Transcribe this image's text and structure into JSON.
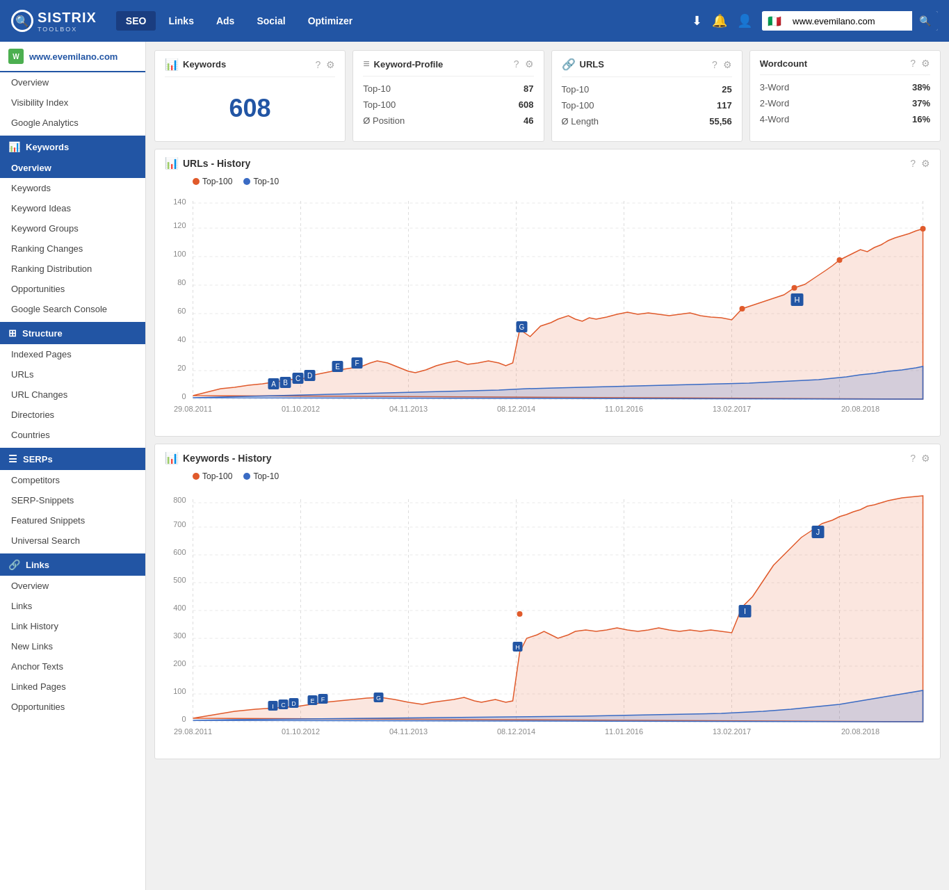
{
  "header": {
    "logo": "SISTRIX",
    "logo_sub": "TOOLBOX",
    "search_placeholder": "www.evemilano.com",
    "flag": "🇮🇹",
    "nav": [
      {
        "label": "SEO",
        "active": true
      },
      {
        "label": "Links",
        "active": false
      },
      {
        "label": "Ads",
        "active": false
      },
      {
        "label": "Social",
        "active": false
      },
      {
        "label": "Optimizer",
        "active": false
      }
    ]
  },
  "sidebar": {
    "domain": "www.evemilano.com",
    "items_top": [
      {
        "label": "Overview"
      },
      {
        "label": "Visibility Index"
      },
      {
        "label": "Google Analytics"
      }
    ],
    "section_keywords": "Keywords",
    "keywords_items": [
      {
        "label": "Overview",
        "active": true
      },
      {
        "label": "Keywords"
      },
      {
        "label": "Keyword Ideas"
      },
      {
        "label": "Keyword Groups"
      },
      {
        "label": "Ranking Changes"
      },
      {
        "label": "Ranking Distribution"
      },
      {
        "label": "Opportunities"
      },
      {
        "label": "Google Search Console"
      }
    ],
    "section_structure": "Structure",
    "structure_items": [
      {
        "label": "Indexed Pages"
      },
      {
        "label": "URLs"
      },
      {
        "label": "URL Changes"
      },
      {
        "label": "Directories"
      },
      {
        "label": "Countries"
      }
    ],
    "section_serps": "SERPs",
    "serps_items": [
      {
        "label": "Competitors"
      },
      {
        "label": "SERP-Snippets"
      },
      {
        "label": "Featured Snippets"
      },
      {
        "label": "Universal Search"
      }
    ],
    "section_links": "Links",
    "links_items": [
      {
        "label": "Overview"
      },
      {
        "label": "Links"
      },
      {
        "label": "Link History"
      },
      {
        "label": "New Links"
      },
      {
        "label": "Anchor Texts"
      },
      {
        "label": "Linked Pages"
      },
      {
        "label": "Opportunities"
      }
    ]
  },
  "stats": {
    "keywords": {
      "title": "Keywords",
      "big_value": "608"
    },
    "keyword_profile": {
      "title": "Keyword-Profile",
      "rows": [
        {
          "label": "Top-10",
          "value": "87"
        },
        {
          "label": "Top-100",
          "value": "608"
        },
        {
          "label": "Ø Position",
          "value": "46"
        }
      ]
    },
    "urls": {
      "title": "URLS",
      "rows": [
        {
          "label": "Top-10",
          "value": "25"
        },
        {
          "label": "Top-100",
          "value": "117"
        },
        {
          "label": "Ø Length",
          "value": "55,56"
        }
      ]
    },
    "wordcount": {
      "title": "Wordcount",
      "rows": [
        {
          "label": "3-Word",
          "value": "38%"
        },
        {
          "label": "2-Word",
          "value": "37%"
        },
        {
          "label": "4-Word",
          "value": "16%"
        }
      ]
    }
  },
  "charts": {
    "urls_history": {
      "title": "URLs - History",
      "legend": [
        {
          "label": "Top-100",
          "color": "#e05a2b"
        },
        {
          "label": "Top-10",
          "color": "#3a6bc4"
        }
      ],
      "x_labels": [
        "29.08.2011",
        "01.10.2012",
        "04.11.2013",
        "08.12.2014",
        "11.01.2016",
        "13.02.2017",
        "20.08.2018"
      ],
      "y_labels": [
        "20",
        "40",
        "60",
        "80",
        "100",
        "120",
        "140"
      ]
    },
    "keywords_history": {
      "title": "Keywords - History",
      "legend": [
        {
          "label": "Top-100",
          "color": "#e05a2b"
        },
        {
          "label": "Top-10",
          "color": "#3a6bc4"
        }
      ],
      "x_labels": [
        "29.08.2011",
        "01.10.2012",
        "04.11.2013",
        "08.12.2014",
        "11.01.2016",
        "13.02.2017",
        "20.08.2018"
      ],
      "y_labels": [
        "100",
        "200",
        "300",
        "400",
        "500",
        "600",
        "700",
        "800"
      ]
    }
  }
}
